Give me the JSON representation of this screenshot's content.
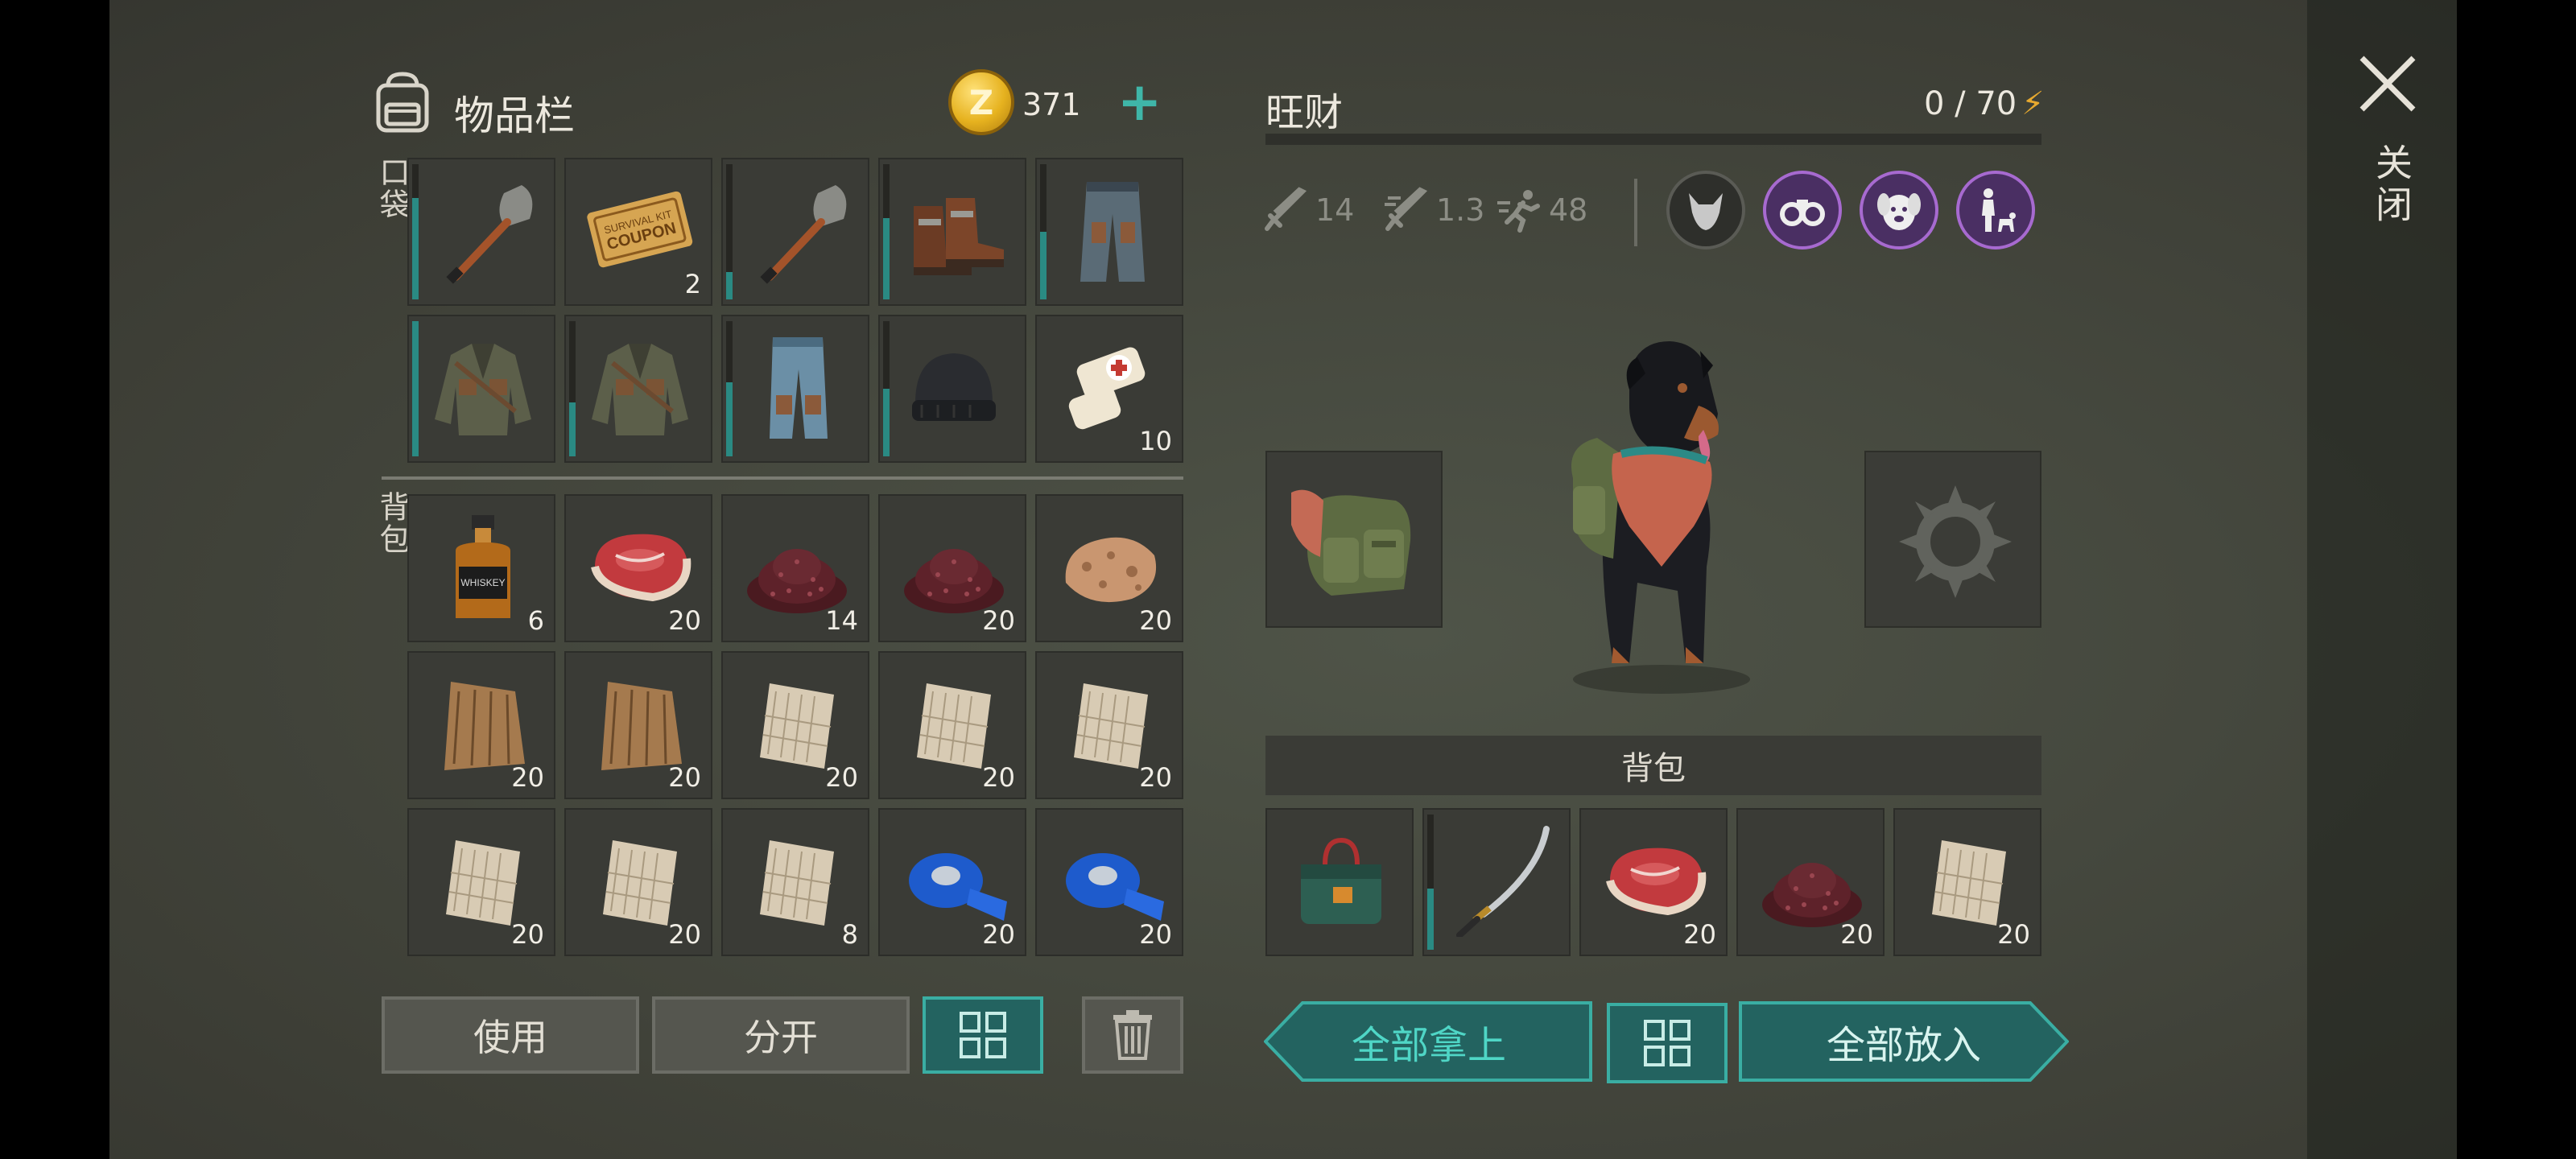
{
  "inventory": {
    "title": "物品栏",
    "coins": "371",
    "add_symbol": "+",
    "pocket_label": "口袋",
    "backpack_label": "背包",
    "pocket_items": [
      {
        "icon": "shovel-icon",
        "qty": "",
        "durability": 0.75
      },
      {
        "icon": "coupon-icon",
        "qty": "2",
        "durability": null
      },
      {
        "icon": "shovel-icon",
        "qty": "",
        "durability": 0.2
      },
      {
        "icon": "boots-icon",
        "qty": "",
        "durability": 0.6
      },
      {
        "icon": "pants-icon",
        "qty": "",
        "durability": 0.5
      },
      {
        "icon": "jacket-icon",
        "qty": "",
        "durability": 1.0
      },
      {
        "icon": "jacket-icon",
        "qty": "",
        "durability": 0.4
      },
      {
        "icon": "jeans-icon",
        "qty": "",
        "durability": 0.55
      },
      {
        "icon": "beanie-icon",
        "qty": "",
        "durability": 0.5
      },
      {
        "icon": "bandage-icon",
        "qty": "10",
        "durability": null
      }
    ],
    "backpack_items": [
      {
        "icon": "whiskey-icon",
        "qty": "6"
      },
      {
        "icon": "steak-icon",
        "qty": "20"
      },
      {
        "icon": "berries-icon",
        "qty": "14"
      },
      {
        "icon": "berries-icon",
        "qty": "20"
      },
      {
        "icon": "stone-icon",
        "qty": "20"
      },
      {
        "icon": "fur-icon",
        "qty": "20"
      },
      {
        "icon": "fur-icon",
        "qty": "20"
      },
      {
        "icon": "cloth-icon",
        "qty": "20"
      },
      {
        "icon": "cloth-icon",
        "qty": "20"
      },
      {
        "icon": "cloth-icon",
        "qty": "20"
      },
      {
        "icon": "cloth-icon",
        "qty": "20"
      },
      {
        "icon": "cloth-icon",
        "qty": "20"
      },
      {
        "icon": "cloth-icon",
        "qty": "8"
      },
      {
        "icon": "tape-icon",
        "qty": "20"
      },
      {
        "icon": "tape-icon",
        "qty": "20"
      }
    ],
    "buttons": {
      "use": "使用",
      "split": "分开"
    }
  },
  "dog": {
    "name": "旺财",
    "energy": "0 / 70",
    "stats": {
      "attack": "14",
      "attack_speed": "1.3",
      "speed": "48"
    },
    "skills": [
      {
        "icon": "wolf-icon",
        "active": false
      },
      {
        "icon": "binoculars-icon",
        "active": true
      },
      {
        "icon": "dog-face-icon",
        "active": true
      },
      {
        "icon": "person-with-dog-icon",
        "active": true
      }
    ],
    "backpack_label": "背包",
    "backpack_items": [
      {
        "icon": "toolbox-icon",
        "qty": "",
        "durability": null
      },
      {
        "icon": "katana-icon",
        "qty": "",
        "durability": 0.45
      },
      {
        "icon": "steak-icon",
        "qty": "20",
        "durability": null
      },
      {
        "icon": "berries-icon",
        "qty": "20",
        "durability": null
      },
      {
        "icon": "cloth-icon",
        "qty": "20",
        "durability": null
      }
    ],
    "buttons": {
      "take_all": "全部拿上",
      "put_all": "全部放入"
    }
  },
  "close": {
    "label": "关闭"
  },
  "colors": {
    "teal": "#3aaea3",
    "purple": "#a76ad0",
    "gold": "#e6b21f",
    "energy": "#e7a92f"
  }
}
